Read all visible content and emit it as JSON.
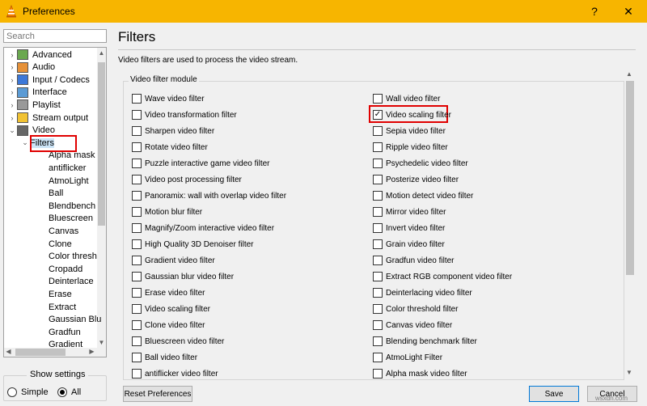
{
  "window": {
    "title": "Preferences",
    "help_label": "?",
    "close_label": "✕"
  },
  "search": {
    "placeholder": "Search"
  },
  "tree": [
    {
      "label": "Advanced",
      "arrow": "›",
      "icon": "advanced-icon"
    },
    {
      "label": "Audio",
      "arrow": "›",
      "icon": "audio-icon"
    },
    {
      "label": "Input / Codecs",
      "arrow": "›",
      "icon": "input-codecs-icon"
    },
    {
      "label": "Interface",
      "arrow": "›",
      "icon": "interface-icon"
    },
    {
      "label": "Playlist",
      "arrow": "›",
      "icon": "playlist-icon"
    },
    {
      "label": "Stream output",
      "arrow": "›",
      "icon": "stream-output-icon"
    },
    {
      "label": "Video",
      "arrow": "⌄",
      "icon": "video-icon"
    },
    {
      "label": "Filters",
      "arrow": "⌄",
      "selected": true
    },
    {
      "label": "Alpha mask"
    },
    {
      "label": "antiflicker"
    },
    {
      "label": "AtmoLight"
    },
    {
      "label": "Ball"
    },
    {
      "label": "Blendbench"
    },
    {
      "label": "Bluescreen"
    },
    {
      "label": "Canvas"
    },
    {
      "label": "Clone"
    },
    {
      "label": "Color thresh"
    },
    {
      "label": "Cropadd"
    },
    {
      "label": "Deinterlace"
    },
    {
      "label": "Erase"
    },
    {
      "label": "Extract"
    },
    {
      "label": "Gaussian Blu"
    },
    {
      "label": "Gradfun"
    },
    {
      "label": "Gradient"
    }
  ],
  "show_settings": {
    "legend": "Show settings",
    "simple": "Simple",
    "all": "All",
    "selected": "All"
  },
  "main": {
    "heading": "Filters",
    "description": "Video filters are used to process the video stream.",
    "group_title": "Video filter module",
    "left_filters": [
      {
        "label": "Wave video filter",
        "checked": false
      },
      {
        "label": "Video transformation filter",
        "checked": false
      },
      {
        "label": "Sharpen video filter",
        "checked": false
      },
      {
        "label": "Rotate video filter",
        "checked": false
      },
      {
        "label": "Puzzle interactive game video filter",
        "checked": false
      },
      {
        "label": "Video post processing filter",
        "checked": false
      },
      {
        "label": "Panoramix: wall with overlap video filter",
        "checked": false
      },
      {
        "label": "Motion blur filter",
        "checked": false
      },
      {
        "label": "Magnify/Zoom interactive video filter",
        "checked": false
      },
      {
        "label": "High Quality 3D Denoiser filter",
        "checked": false
      },
      {
        "label": "Gradient video filter",
        "checked": false
      },
      {
        "label": "Gaussian blur video filter",
        "checked": false
      },
      {
        "label": "Erase video filter",
        "checked": false
      },
      {
        "label": "Video scaling filter",
        "checked": false
      },
      {
        "label": "Clone video filter",
        "checked": false
      },
      {
        "label": "Bluescreen video filter",
        "checked": false
      },
      {
        "label": "Ball video filter",
        "checked": false
      },
      {
        "label": "antiflicker video filter",
        "checked": false
      }
    ],
    "right_filters": [
      {
        "label": "Wall video filter",
        "checked": false
      },
      {
        "label": "Video scaling filter",
        "checked": true
      },
      {
        "label": "Sepia video filter",
        "checked": false
      },
      {
        "label": "Ripple video filter",
        "checked": false
      },
      {
        "label": "Psychedelic video filter",
        "checked": false
      },
      {
        "label": "Posterize video filter",
        "checked": false
      },
      {
        "label": "Motion detect video filter",
        "checked": false
      },
      {
        "label": "Mirror video filter",
        "checked": false
      },
      {
        "label": "Invert video filter",
        "checked": false
      },
      {
        "label": "Grain video filter",
        "checked": false
      },
      {
        "label": "Gradfun video filter",
        "checked": false
      },
      {
        "label": "Extract RGB component video filter",
        "checked": false
      },
      {
        "label": "Deinterlacing video filter",
        "checked": false
      },
      {
        "label": "Color threshold filter",
        "checked": false
      },
      {
        "label": "Canvas video filter",
        "checked": false
      },
      {
        "label": "Blending benchmark filter",
        "checked": false
      },
      {
        "label": "AtmoLight Filter",
        "checked": false
      },
      {
        "label": "Alpha mask video filter",
        "checked": false
      }
    ]
  },
  "buttons": {
    "reset": "Reset Preferences",
    "save": "Save",
    "cancel": "Cancel"
  },
  "watermark": "wsxdn.com",
  "colors": {
    "titlebar": "#f7b500",
    "highlight": "#e00000",
    "selection": "#cce4f7"
  }
}
